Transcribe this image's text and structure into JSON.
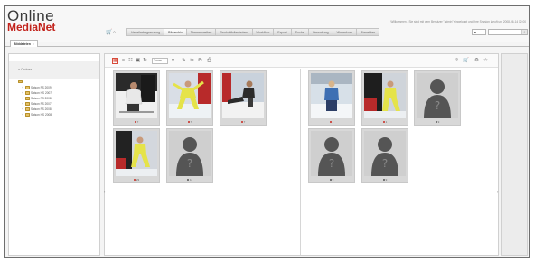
{
  "brand": {
    "name_top": "Online",
    "name_bottom": "MediaNet"
  },
  "header": {
    "welcome": "Willkommen - Sie sind mit dem Benutzer \"admin\" eingeloggt und Ihre Session laeuft um 2008-06-14 12:00",
    "cart_count": "0"
  },
  "menu": [
    {
      "label": "Verteilerbegrenzung",
      "active": false
    },
    {
      "label": "Bildarchiv",
      "active": true
    },
    {
      "label": "Themenwelten",
      "active": false
    },
    {
      "label": "Produktfolienfedern",
      "active": false
    },
    {
      "label": "Workflow",
      "active": false
    },
    {
      "label": "Export",
      "active": false
    },
    {
      "label": "Suche",
      "active": false
    },
    {
      "label": "Verwaltung",
      "active": false
    },
    {
      "label": "Warenkorb",
      "active": false
    },
    {
      "label": "Abmelden",
      "active": false
    }
  ],
  "tab": {
    "label": "Bilddateien",
    "close": "×"
  },
  "sidebar": {
    "title": "« Ordner",
    "root_icon": "folder-icon",
    "items": [
      {
        "label": "Saison FS 2009"
      },
      {
        "label": "Saison HS 2007"
      },
      {
        "label": "Saison FS 2008"
      },
      {
        "label": "Saison FS 2007"
      },
      {
        "label": "Saison FS 2008"
      },
      {
        "label": "Saison HS 2008"
      }
    ]
  },
  "toolbar": {
    "view_select": "Zoom",
    "icons": [
      "grid-view-icon",
      "list-view-icon",
      "table-view-icon",
      "detail-view-icon",
      "refresh-icon",
      "edit-icon",
      "delete-icon",
      "copy-icon",
      "print-icon",
      "export-icon",
      "cart-icon",
      "settings-icon"
    ]
  },
  "left_pane": {
    "items": [
      {
        "type": "photo",
        "label": "7",
        "status": "red"
      },
      {
        "type": "photo",
        "label": "7",
        "status": "red"
      },
      {
        "type": "photo",
        "label": "7",
        "status": "red"
      },
      {
        "type": "photo",
        "label": "23",
        "status": "red"
      },
      {
        "type": "placeholder",
        "label": "11",
        "status": "dark"
      }
    ]
  },
  "right_pane": {
    "items": [
      {
        "type": "photo",
        "label": "1",
        "status": "red"
      },
      {
        "type": "photo",
        "label": "1",
        "status": "red"
      },
      {
        "type": "placeholder",
        "label": "9",
        "status": "dark"
      },
      {
        "type": "placeholder",
        "label": "9",
        "status": "dark"
      },
      {
        "type": "placeholder",
        "label": "9",
        "status": "dark"
      }
    ]
  },
  "colors": {
    "brand_red": "#c2221b",
    "status_red": "#c8281e",
    "jacket_yellow": "#e7e64a"
  }
}
